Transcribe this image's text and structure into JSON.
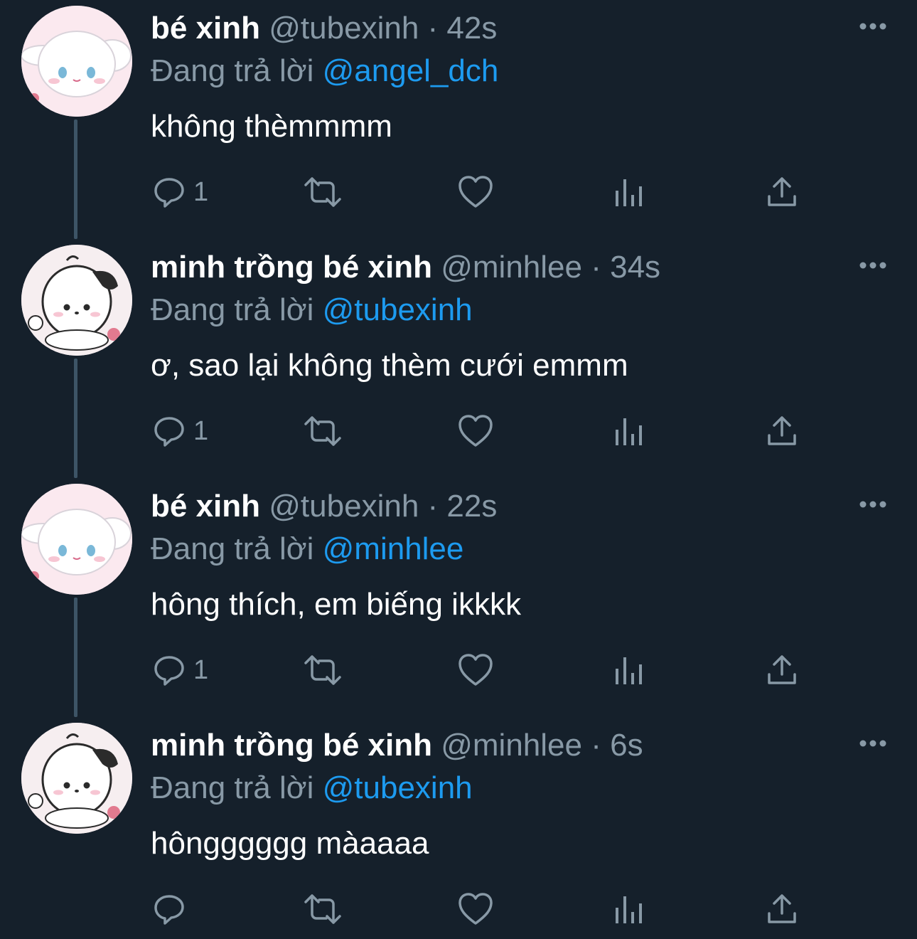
{
  "tweets": [
    {
      "name": "bé xinh",
      "handle": "@tubexinh",
      "separator": "·",
      "time": "42s",
      "replying_prefix": "Đang trả lời",
      "mention": "@angel_dch",
      "text": "không thèmmmm",
      "reply_count": "1",
      "avatar": "cinnamoroll-avatar"
    },
    {
      "name": "minh trồng bé xinh",
      "handle": "@minhlee",
      "separator": "·",
      "time": "34s",
      "replying_prefix": "Đang trả lời",
      "mention": "@tubexinh",
      "text": "ơ, sao lại không thèm cưới emmm",
      "reply_count": "1",
      "avatar": "pochacco-avatar"
    },
    {
      "name": "bé xinh",
      "handle": "@tubexinh",
      "separator": "·",
      "time": "22s",
      "replying_prefix": "Đang trả lời",
      "mention": "@minhlee",
      "text": "hông thích, em biếng ikkkk",
      "reply_count": "1",
      "avatar": "cinnamoroll-avatar"
    },
    {
      "name": "minh trồng bé xinh",
      "handle": "@minhlee",
      "separator": "·",
      "time": "6s",
      "replying_prefix": "Đang trả lời",
      "mention": "@tubexinh",
      "text": "hôngggggg màaaaa",
      "reply_count": "",
      "avatar": "pochacco-avatar"
    }
  ],
  "icons": {
    "reply": "reply-icon",
    "retweet": "retweet-icon",
    "like": "heart-icon",
    "views": "bar-chart-icon",
    "share": "share-icon",
    "more": "more-dots-icon"
  },
  "colors": {
    "background": "#15202b",
    "text": "#ffffff",
    "muted": "#8899a6",
    "link": "#1d9bf0",
    "thread_line": "#3d5466"
  }
}
